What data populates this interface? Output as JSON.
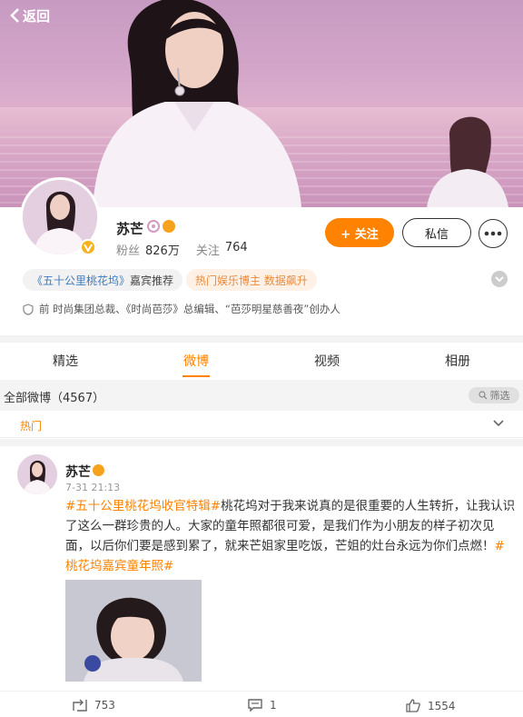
{
  "nav": {
    "back_label": "返回"
  },
  "profile": {
    "name": "苏芒",
    "followers_label": "粉丝",
    "followers_value": "826万",
    "following_label": "关注",
    "following_value": "764",
    "follow_button": "+ 关注",
    "message_button": "私信"
  },
  "tags": {
    "tag1_link": "《五十公里桃花坞》",
    "tag1_suffix": "嘉宾推荐",
    "tag2": "热门娱乐博主 数据飙升"
  },
  "bio": "前 时尚集团总裁、《时尚芭莎》总编辑、“芭莎明星慈善夜”创办人",
  "tabs": [
    "精选",
    "微博",
    "视频",
    "相册"
  ],
  "feed": {
    "all_label": "全部微博（4567）",
    "filter_label": "筛选",
    "hot_label": "热门"
  },
  "post": {
    "author": "苏芒",
    "time": "7-31 21:13",
    "topic1": "#五十公里桃花坞收官特辑#",
    "body": "桃花坞对于我来说真的是很重要的人生转折，让我认识了这么一群珍贵的人。大家的童年照都很可爱，是我们作为小朋友的样子初次见面，以后你们要是感到累了，就来芒姐家里吃饭，芒姐的灶台永远为你们点燃！",
    "topic2": "#桃花坞嘉宾童年照#",
    "reposts": "753",
    "comments": "1",
    "likes": "1554"
  },
  "colors": {
    "accent": "#ff8200",
    "badge": "#f7b21c",
    "link": "#3d7bbf"
  },
  "icons": [
    "chevron-left-icon",
    "verified-badge-icon",
    "more-dots-icon",
    "chevron-down-icon",
    "shield-icon",
    "repost-icon",
    "comment-icon",
    "like-icon"
  ]
}
